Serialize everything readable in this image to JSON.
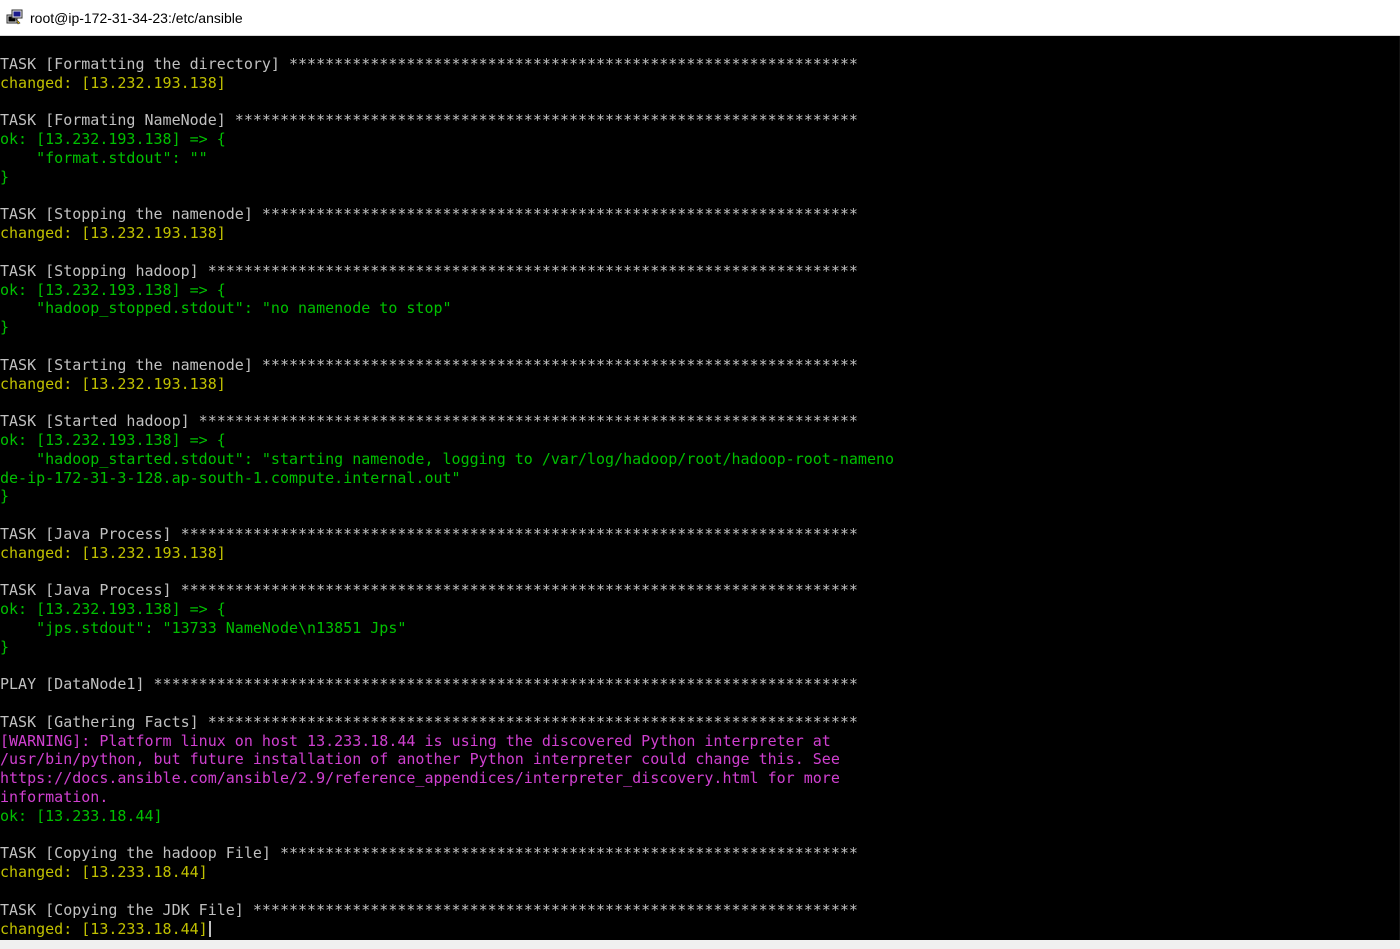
{
  "window": {
    "title": "root@ip-172-31-34-23:/etc/ansible",
    "icon": "putty-terminal-icon"
  },
  "colors": {
    "background": "#000000",
    "text": "#c0c0c0",
    "changed": "#c0c000",
    "ok": "#00c000",
    "warning": "#d040d0"
  },
  "terminal": {
    "lines": [
      {
        "text": "TASK [Formatting the directory] ***************************************************************",
        "style": "white"
      },
      {
        "text": "changed: [13.232.193.138]",
        "style": "yellow"
      },
      {
        "text": "",
        "style": "white"
      },
      {
        "text": "TASK [Formating NameNode] *********************************************************************",
        "style": "white"
      },
      {
        "text": "ok: [13.232.193.138] => {",
        "style": "green"
      },
      {
        "text": "    \"format.stdout\": \"\"",
        "style": "green"
      },
      {
        "text": "}",
        "style": "green"
      },
      {
        "text": "",
        "style": "white"
      },
      {
        "text": "TASK [Stopping the namenode] ******************************************************************",
        "style": "white"
      },
      {
        "text": "changed: [13.232.193.138]",
        "style": "yellow"
      },
      {
        "text": "",
        "style": "white"
      },
      {
        "text": "TASK [Stopping hadoop] ************************************************************************",
        "style": "white"
      },
      {
        "text": "ok: [13.232.193.138] => {",
        "style": "green"
      },
      {
        "text": "    \"hadoop_stopped.stdout\": \"no namenode to stop\"",
        "style": "green"
      },
      {
        "text": "}",
        "style": "green"
      },
      {
        "text": "",
        "style": "white"
      },
      {
        "text": "TASK [Starting the namenode] ******************************************************************",
        "style": "white"
      },
      {
        "text": "changed: [13.232.193.138]",
        "style": "yellow"
      },
      {
        "text": "",
        "style": "white"
      },
      {
        "text": "TASK [Started hadoop] *************************************************************************",
        "style": "white"
      },
      {
        "text": "ok: [13.232.193.138] => {",
        "style": "green"
      },
      {
        "text": "    \"hadoop_started.stdout\": \"starting namenode, logging to /var/log/hadoop/root/hadoop-root-nameno",
        "style": "green"
      },
      {
        "text": "de-ip-172-31-3-128.ap-south-1.compute.internal.out\"",
        "style": "green"
      },
      {
        "text": "}",
        "style": "green"
      },
      {
        "text": "",
        "style": "white"
      },
      {
        "text": "TASK [Java Process] ***************************************************************************",
        "style": "white"
      },
      {
        "text": "changed: [13.232.193.138]",
        "style": "yellow"
      },
      {
        "text": "",
        "style": "white"
      },
      {
        "text": "TASK [Java Process] ***************************************************************************",
        "style": "white"
      },
      {
        "text": "ok: [13.232.193.138] => {",
        "style": "green"
      },
      {
        "text": "    \"jps.stdout\": \"13733 NameNode\\n13851 Jps\"",
        "style": "green"
      },
      {
        "text": "}",
        "style": "green"
      },
      {
        "text": "",
        "style": "white"
      },
      {
        "text": "PLAY [DataNode1] ******************************************************************************",
        "style": "white"
      },
      {
        "text": "",
        "style": "white"
      },
      {
        "text": "TASK [Gathering Facts] ************************************************************************",
        "style": "white"
      },
      {
        "text": "[WARNING]: Platform linux on host 13.233.18.44 is using the discovered Python interpreter at",
        "style": "magenta"
      },
      {
        "text": "/usr/bin/python, but future installation of another Python interpreter could change this. See",
        "style": "magenta"
      },
      {
        "text": "https://docs.ansible.com/ansible/2.9/reference_appendices/interpreter_discovery.html for more",
        "style": "magenta"
      },
      {
        "text": "information.",
        "style": "magenta"
      },
      {
        "text": "ok: [13.233.18.44]",
        "style": "green"
      },
      {
        "text": "",
        "style": "white"
      },
      {
        "text": "TASK [Copying the hadoop File] ****************************************************************",
        "style": "white"
      },
      {
        "text": "changed: [13.233.18.44]",
        "style": "yellow"
      },
      {
        "text": "",
        "style": "white"
      },
      {
        "text": "TASK [Copying the JDK File] *******************************************************************",
        "style": "white"
      },
      {
        "text": "changed: [13.233.18.44]",
        "style": "yellow"
      }
    ]
  }
}
